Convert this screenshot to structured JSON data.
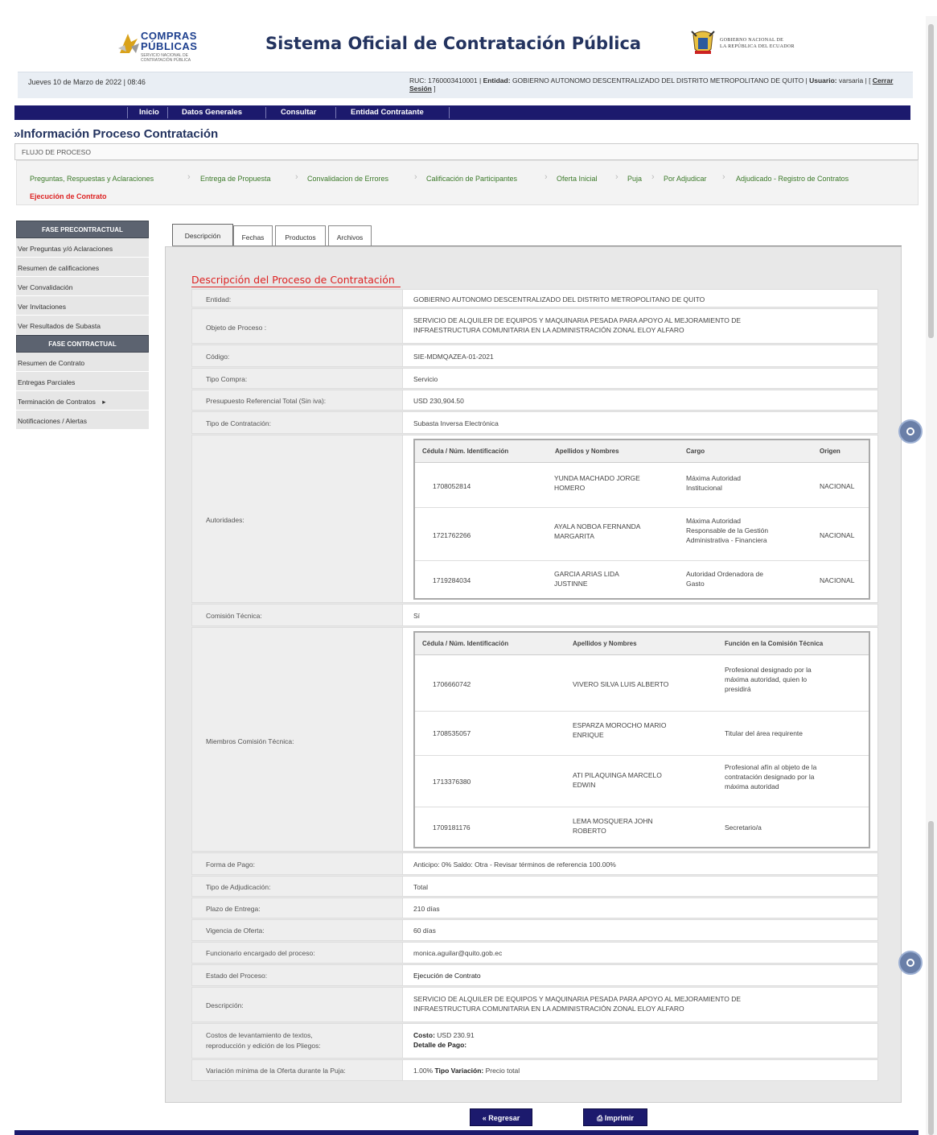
{
  "header": {
    "logo_line1": "COMPRAS",
    "logo_line2": "PÚBLICAS",
    "logo_tag": "SERVICIO NACIONAL DE CONTRATACIÓN PÚBLICA",
    "title": "Sistema Oficial de Contratación Pública",
    "gov_line1": "GOBIERNO NACIONAL DE",
    "gov_line2": "LA REPÚBLICA DEL ECUADOR"
  },
  "infobar": {
    "date": "Jueves 10 de Marzo de 2022 | 08:46",
    "ruc_label": "RUC:",
    "ruc": "1760003410001",
    "entidad_label": "Entidad:",
    "entidad": "GOBIERNO AUTONOMO DESCENTRALIZADO DEL DISTRITO METROPOLITANO DE QUITO",
    "usuario_label": "Usuario:",
    "usuario": "varsaria",
    "logout": "Cerrar Sesión"
  },
  "nav": [
    "Inicio",
    "Datos Generales",
    "Consultar",
    "Entidad Contratante"
  ],
  "page_title": "»Información Proceso Contratación",
  "flujo_label": "FLUJO DE PROCESO",
  "flow_steps": [
    "Preguntas, Respuestas y Aclaraciones",
    "Entrega de Propuesta",
    "Convalidacion de Errores",
    "Calificación de Participantes",
    "Oferta Inicial",
    "Puja",
    "Por Adjudicar",
    "Adjudicado - Registro de Contratos"
  ],
  "flow_current": "Ejecución de Contrato",
  "sidebar": {
    "section1": "FASE PRECONTRACTUAL",
    "items1": [
      "Ver Preguntas y/ó Aclaraciones",
      "Resumen de calificaciones",
      "Ver Convalidación",
      "Ver Invitaciones",
      "Ver Resultados de Subasta"
    ],
    "section2": "FASE CONTRACTUAL",
    "items2": [
      "Resumen de Contrato",
      "Entregas Parciales",
      "Terminación de Contratos",
      "Notificaciones / Alertas"
    ]
  },
  "tabs": [
    "Descripción",
    "Fechas",
    "Productos",
    "Archivos"
  ],
  "section_title": "Descripción del Proceso de Contratación",
  "fields": {
    "entidad_l": "Entidad:",
    "entidad_v": "GOBIERNO AUTONOMO DESCENTRALIZADO DEL DISTRITO METROPOLITANO DE QUITO",
    "objeto_l": "Objeto de Proceso :",
    "objeto_v1": "SERVICIO DE ALQUILER DE EQUIPOS Y MAQUINARIA PESADA PARA APOYO AL MEJORAMIENTO DE",
    "objeto_v2": "INFRAESTRUCTURA COMUNITARIA EN LA ADMINISTRACIÓN ZONAL ELOY ALFARO",
    "codigo_l": "Código:",
    "codigo_v": "SIE-MDMQAZEA-01-2021",
    "tipo_compra_l": "Tipo Compra:",
    "tipo_compra_v": "Servicio",
    "presupuesto_l": "Presupuesto Referencial Total (Sin iva):",
    "presupuesto_v": "USD 230,904.50",
    "tipo_contratacion_l": "Tipo de Contratación:",
    "tipo_contratacion_v": "Subasta Inversa Electrónica",
    "autoridades_l": "Autoridades:",
    "comision_l": "Comisión Técnica:",
    "comision_v": "Sí",
    "miembros_l": "Miembros Comisión Técnica:",
    "forma_pago_l": "Forma de Pago:",
    "forma_pago_v": "Anticipo: 0% Saldo: Otra - Revisar términos de referencia 100.00%",
    "tipo_adj_l": "Tipo de Adjudicación:",
    "tipo_adj_v": "Total",
    "plazo_l": "Plazo de Entrega:",
    "plazo_v": "210 días",
    "vigencia_l": "Vigencia de Oferta:",
    "vigencia_v": "60 días",
    "funcionario_l": "Funcionario encargado del proceso:",
    "funcionario_v": "monica.aguilar@quito.gob.ec",
    "estado_l": "Estado del Proceso:",
    "estado_v": "Ejecución de Contrato",
    "descripcion_l": "Descripción:",
    "descripcion_v1": "SERVICIO DE ALQUILER DE EQUIPOS Y MAQUINARIA PESADA PARA APOYO AL MEJORAMIENTO DE",
    "descripcion_v2": "INFRAESTRUCTURA COMUNITARIA EN LA ADMINISTRACIÓN ZONAL ELOY ALFARO",
    "costos_l1": "Costos de levantamiento de textos,",
    "costos_l2": "reproducción y edición de los Pliegos:",
    "costo_label": "Costo:",
    "costo_v": "USD 230.91",
    "detalle_label": "Detalle de Pago:",
    "variacion_l": "Variación mínima de la Oferta durante la Puja:",
    "variacion_v": "1.00%",
    "tipo_var_label": "Tipo Variación:",
    "tipo_var_v": "Precio total"
  },
  "autoridades": {
    "headers": [
      "Cédula / Núm. Identificación",
      "Apellidos y Nombres",
      "Cargo",
      "Origen"
    ],
    "rows": [
      {
        "id": "1708052814",
        "name1": "YUNDA MACHADO JORGE",
        "name2": "HOMERO",
        "cargo1": "Máxima Autoridad",
        "cargo2": "Institucional",
        "cargo3": "",
        "origen": "NACIONAL"
      },
      {
        "id": "1721762266",
        "name1": "AYALA NOBOA FERNANDA",
        "name2": "MARGARITA",
        "cargo1": "Máxima Autoridad",
        "cargo2": "Responsable de la Gestión",
        "cargo3": "Administrativa - Financiera",
        "origen": "NACIONAL"
      },
      {
        "id": "1719284034",
        "name1": "GARCIA ARIAS LIDA",
        "name2": "JUSTINNE",
        "cargo1": "Autoridad Ordenadora de",
        "cargo2": "Gasto",
        "cargo3": "",
        "origen": "NACIONAL"
      }
    ]
  },
  "miembros": {
    "headers": [
      "Cédula / Núm. Identificación",
      "Apellidos y Nombres",
      "Función en la Comisión Técnica"
    ],
    "rows": [
      {
        "id": "1706660742",
        "name1": "VIVERO SILVA LUIS ALBERTO",
        "name2": "",
        "f1": "Profesional designado por la",
        "f2": "máxima autoridad, quien lo",
        "f3": "presidirá"
      },
      {
        "id": "1708535057",
        "name1": "ESPARZA MOROCHO MARIO",
        "name2": "ENRIQUE",
        "f1": "Titular del área requirente",
        "f2": "",
        "f3": ""
      },
      {
        "id": "1713376380",
        "name1": "ATI PILAQUINGA MARCELO",
        "name2": "EDWIN",
        "f1": "Profesional afín al objeto de la",
        "f2": "contratación designado por la",
        "f3": "máxima autoridad"
      },
      {
        "id": "1709181176",
        "name1": "LEMA MOSQUERA JOHN",
        "name2": "ROBERTO",
        "f1": "Secretario/a",
        "f2": "",
        "f3": ""
      }
    ]
  },
  "buttons": {
    "back": "« Regresar",
    "print": "Imprimir"
  },
  "colors": {
    "nav": "#1c1a6d",
    "accent_red": "#dd2222",
    "flow_green": "#3c7a2a"
  }
}
